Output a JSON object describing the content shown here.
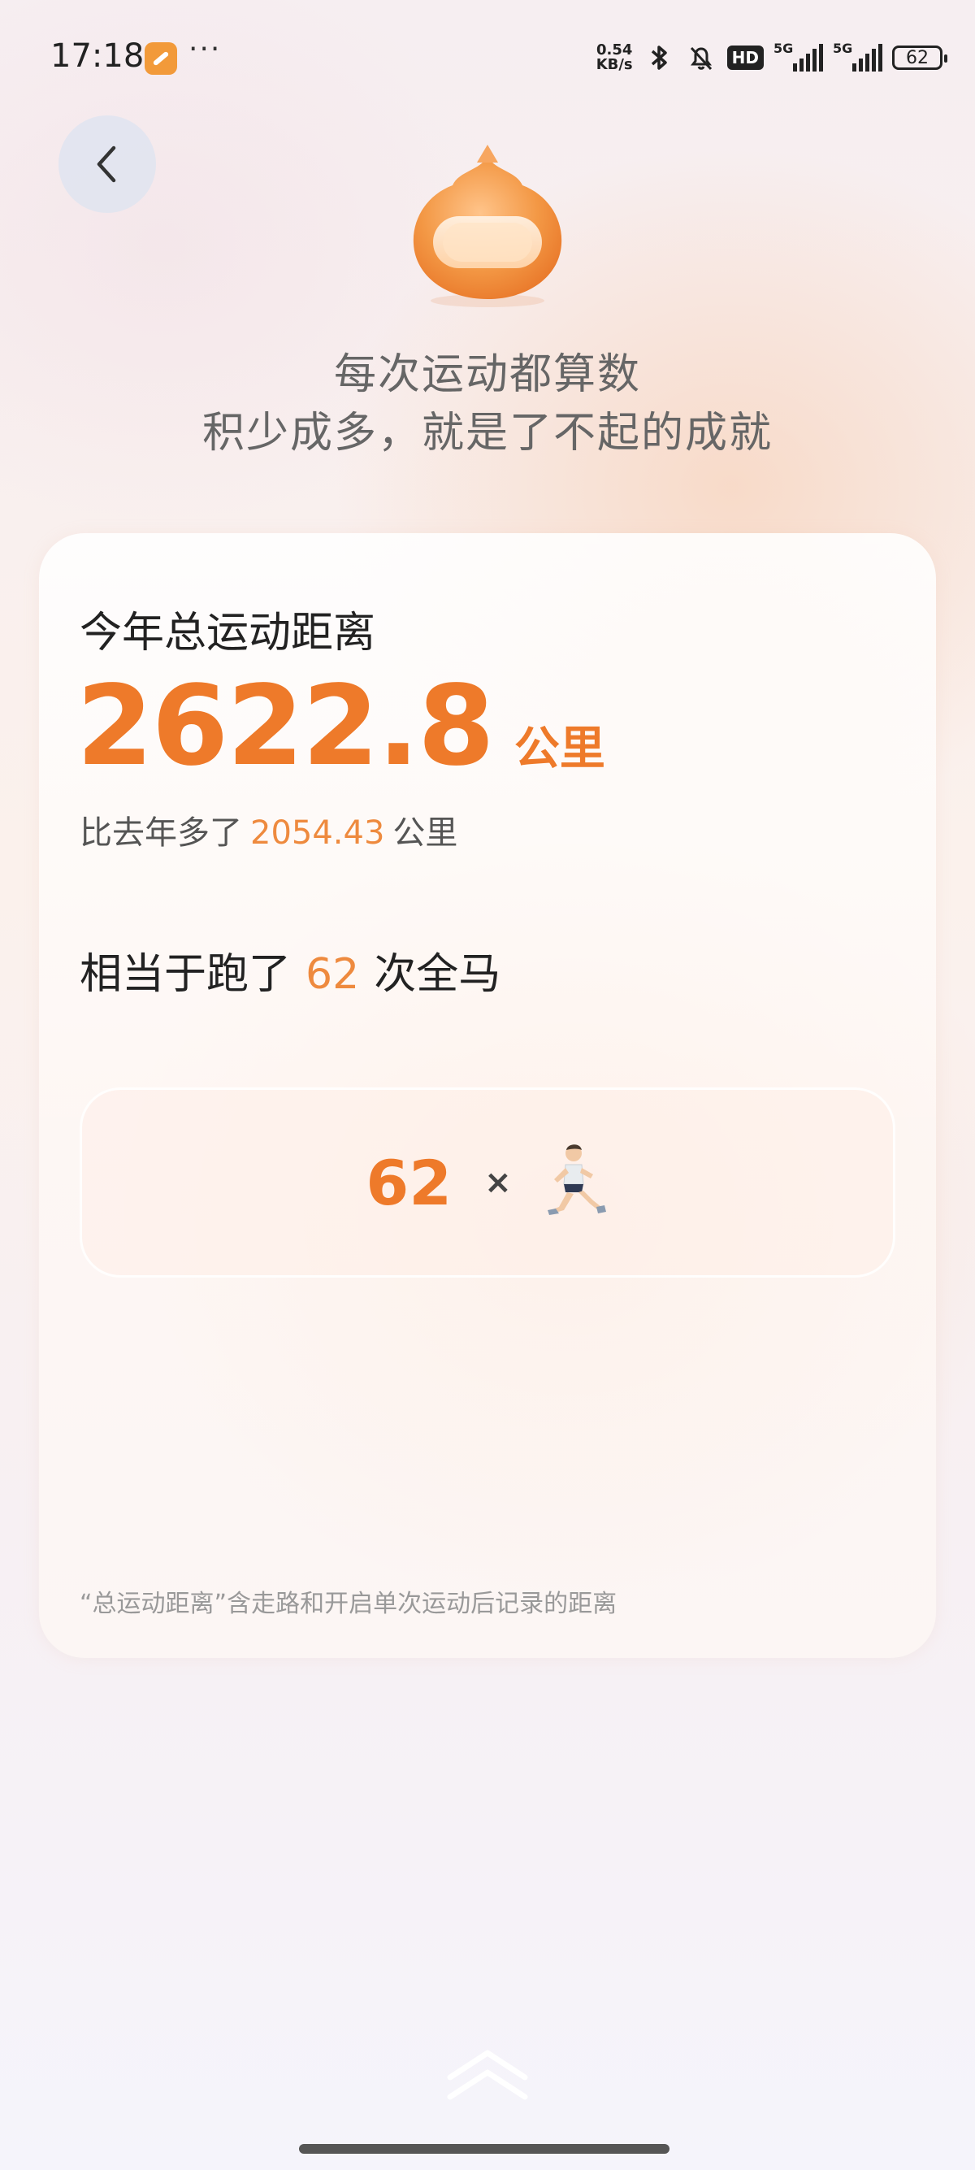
{
  "status_bar": {
    "time": "17:18",
    "more": "···",
    "net_speed_value": "0.54",
    "net_speed_unit": "KB/s",
    "hd_label": "HD",
    "signal_label_1": "5G",
    "signal_label_2": "5G",
    "battery": "62"
  },
  "header": {
    "headline_line1": "每次运动都算数",
    "headline_line2": "积少成多，就是了不起的成就"
  },
  "card": {
    "title": "今年总运动距离",
    "distance_value": "2622.8",
    "distance_unit": "公里",
    "compare_prefix": "比去年多了",
    "compare_value": "2054.43",
    "compare_unit": "公里",
    "equiv_prefix": "相当于跑了",
    "equiv_value": "62",
    "equiv_suffix": "次全马",
    "runner_count": "62",
    "times_sign": "×",
    "footnote": "“总运动距离”含走路和开启单次运动后记录的距离"
  },
  "colors": {
    "accent": "#ee7a2a",
    "accent_light": "#ee8a3e"
  },
  "icons": {
    "back": "chevron-left-icon",
    "runner": "runner-icon",
    "swipe_up": "double-chevron-up-icon"
  }
}
